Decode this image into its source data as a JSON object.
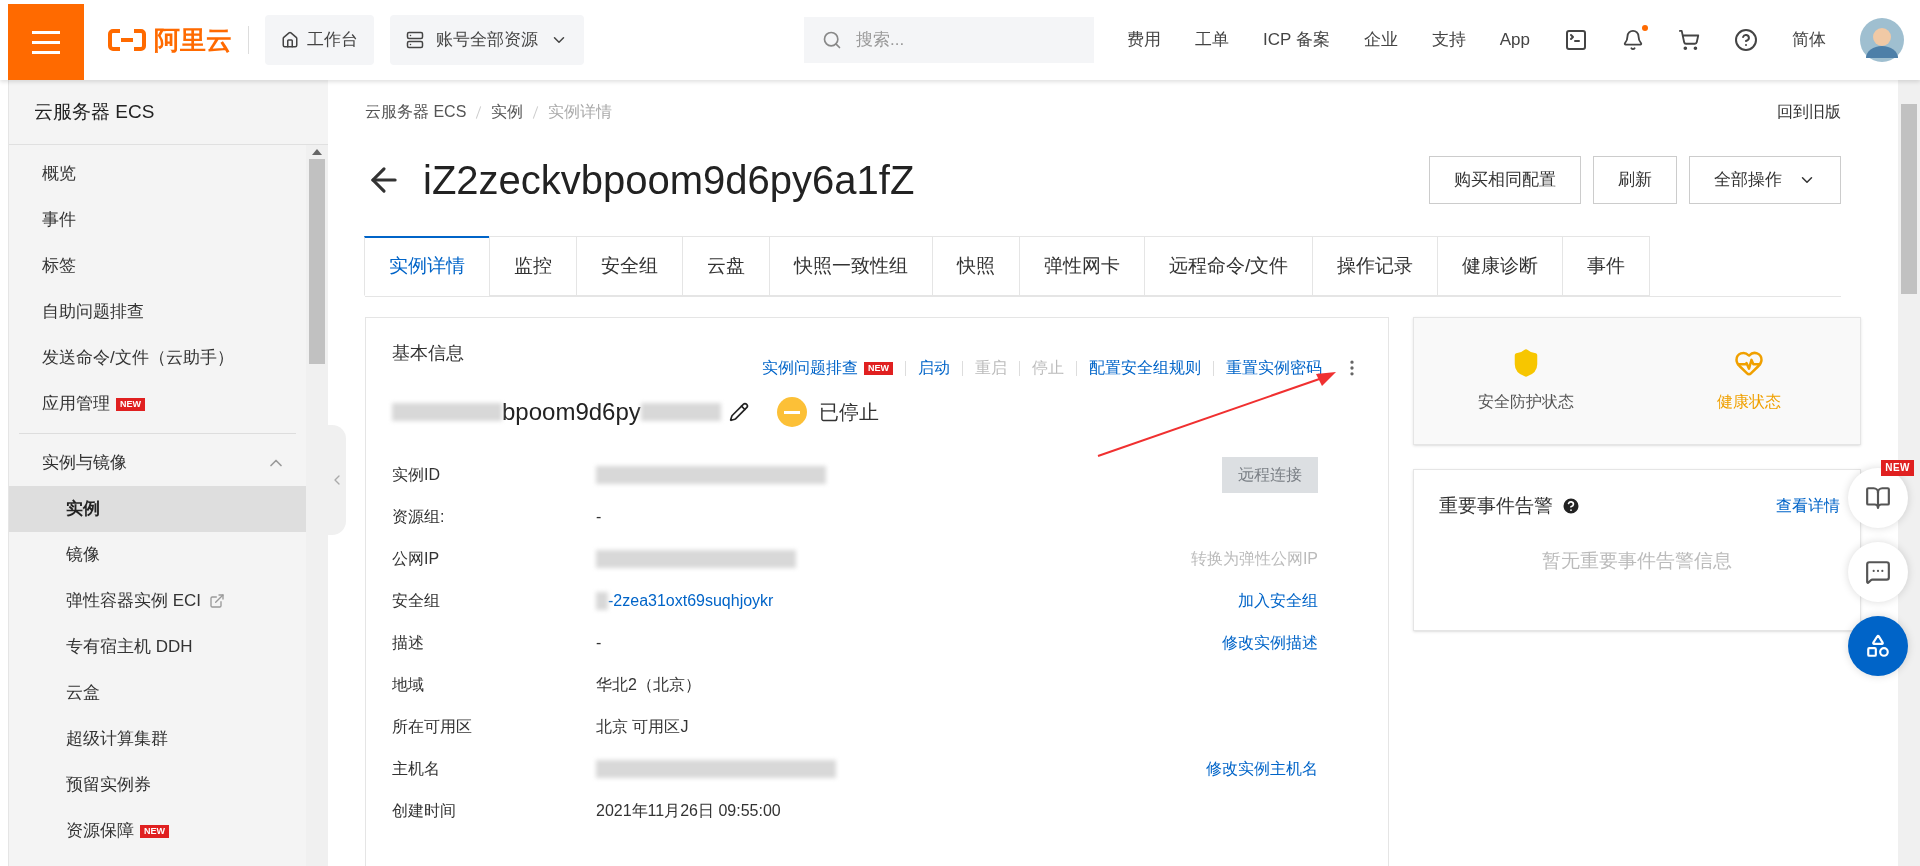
{
  "topbar": {
    "logo_text": "阿里云",
    "workbench": "工作台",
    "resources": "账号全部资源",
    "search": {
      "placeholder": "搜索..."
    },
    "links": [
      "费用",
      "工单",
      "ICP 备案",
      "企业",
      "支持",
      "App"
    ],
    "notifications": {
      "unread": true
    },
    "language": "简体"
  },
  "sidebar": {
    "title": "云服务器 ECS",
    "items": [
      {
        "label": "概览",
        "selected": false
      },
      {
        "label": "事件",
        "selected": false
      },
      {
        "label": "标签",
        "selected": false
      },
      {
        "label": "自助问题排查",
        "selected": false
      },
      {
        "label": "发送命令/文件（云助手）",
        "selected": false
      },
      {
        "label": "应用管理",
        "selected": false,
        "badge": "NEW"
      }
    ],
    "groups": [
      {
        "label": "实例与镜像",
        "expanded": true,
        "children": [
          {
            "label": "实例",
            "selected": true
          },
          {
            "label": "镜像",
            "selected": false
          },
          {
            "label": "弹性容器实例 ECI",
            "selected": false,
            "external": true
          },
          {
            "label": "专有宿主机 DDH",
            "selected": false
          },
          {
            "label": "云盒",
            "selected": false
          },
          {
            "label": "超级计算集群",
            "selected": false
          },
          {
            "label": "预留实例券",
            "selected": false
          },
          {
            "label": "资源保障",
            "selected": false,
            "badge": "NEW"
          }
        ]
      }
    ]
  },
  "breadcrumb": [
    "云服务器 ECS",
    "实例",
    "实例详情"
  ],
  "old_version": "回到旧版",
  "title": "iZ2zeckvbpoom9d6py6a1fZ",
  "header_buttons": [
    {
      "label": "购买相同配置",
      "kind": "plain"
    },
    {
      "label": "刷新",
      "kind": "plain"
    },
    {
      "label": "全部操作",
      "kind": "dropdown"
    }
  ],
  "tabs": [
    {
      "label": "实例详情",
      "selected": true
    },
    {
      "label": "监控",
      "selected": false
    },
    {
      "label": "安全组",
      "selected": false
    },
    {
      "label": "云盘",
      "selected": false
    },
    {
      "label": "快照一致性组",
      "selected": false
    },
    {
      "label": "快照",
      "selected": false
    },
    {
      "label": "弹性网卡",
      "selected": false
    },
    {
      "label": "远程命令/文件",
      "selected": false
    },
    {
      "label": "操作记录",
      "selected": false
    },
    {
      "label": "健康诊断",
      "selected": false
    },
    {
      "label": "事件",
      "selected": false
    }
  ],
  "basic_info": {
    "title": "基本信息",
    "actions": [
      {
        "label": "实例问题排查",
        "disabled": false,
        "badge": "NEW"
      },
      {
        "label": "启动",
        "disabled": false
      },
      {
        "label": "重启",
        "disabled": true
      },
      {
        "label": "停止",
        "disabled": true
      },
      {
        "label": "配置安全组规则",
        "disabled": false
      },
      {
        "label": "重置实例密码",
        "disabled": false
      }
    ],
    "instance_name": "bpoom9d6py",
    "status": "已停止",
    "rows": [
      {
        "label": "实例ID",
        "kind": "blurred",
        "action": {
          "label": "远程连接",
          "kind": "button",
          "disabled": true
        }
      },
      {
        "label": "资源组:",
        "kind": "text",
        "value": "-"
      },
      {
        "label": "公网IP",
        "kind": "blurred",
        "action": {
          "label": "转换为弹性公网IP",
          "kind": "link",
          "disabled": true
        }
      },
      {
        "label": "安全组",
        "kind": "link",
        "value": "-2zea31oxt69suqhjoykr",
        "action": {
          "label": "加入安全组",
          "kind": "link",
          "disabled": false
        }
      },
      {
        "label": "描述",
        "kind": "text",
        "value": "-",
        "action": {
          "label": "修改实例描述",
          "kind": "link",
          "disabled": false
        }
      },
      {
        "label": "地域",
        "kind": "text",
        "value": "华北2（北京）"
      },
      {
        "label": "所在可用区",
        "kind": "text",
        "value": "北京 可用区J"
      },
      {
        "label": "主机名",
        "kind": "blurred",
        "action": {
          "label": "修改实例主机名",
          "kind": "link",
          "disabled": false
        }
      },
      {
        "label": "创建时间",
        "kind": "text",
        "value": "2021年11月26日 09:55:00"
      }
    ]
  },
  "status_card": [
    {
      "label": "安全防护状态",
      "kind": "shield",
      "highlighted": false
    },
    {
      "label": "健康状态",
      "kind": "health",
      "highlighted": true
    }
  ],
  "alerts": {
    "title": "重要事件告警",
    "link": "查看详情",
    "empty": "暂无重要事件告警信息"
  },
  "floating": [
    {
      "kind": "guide",
      "badge": "NEW"
    },
    {
      "kind": "chat"
    },
    {
      "kind": "apps"
    }
  ]
}
